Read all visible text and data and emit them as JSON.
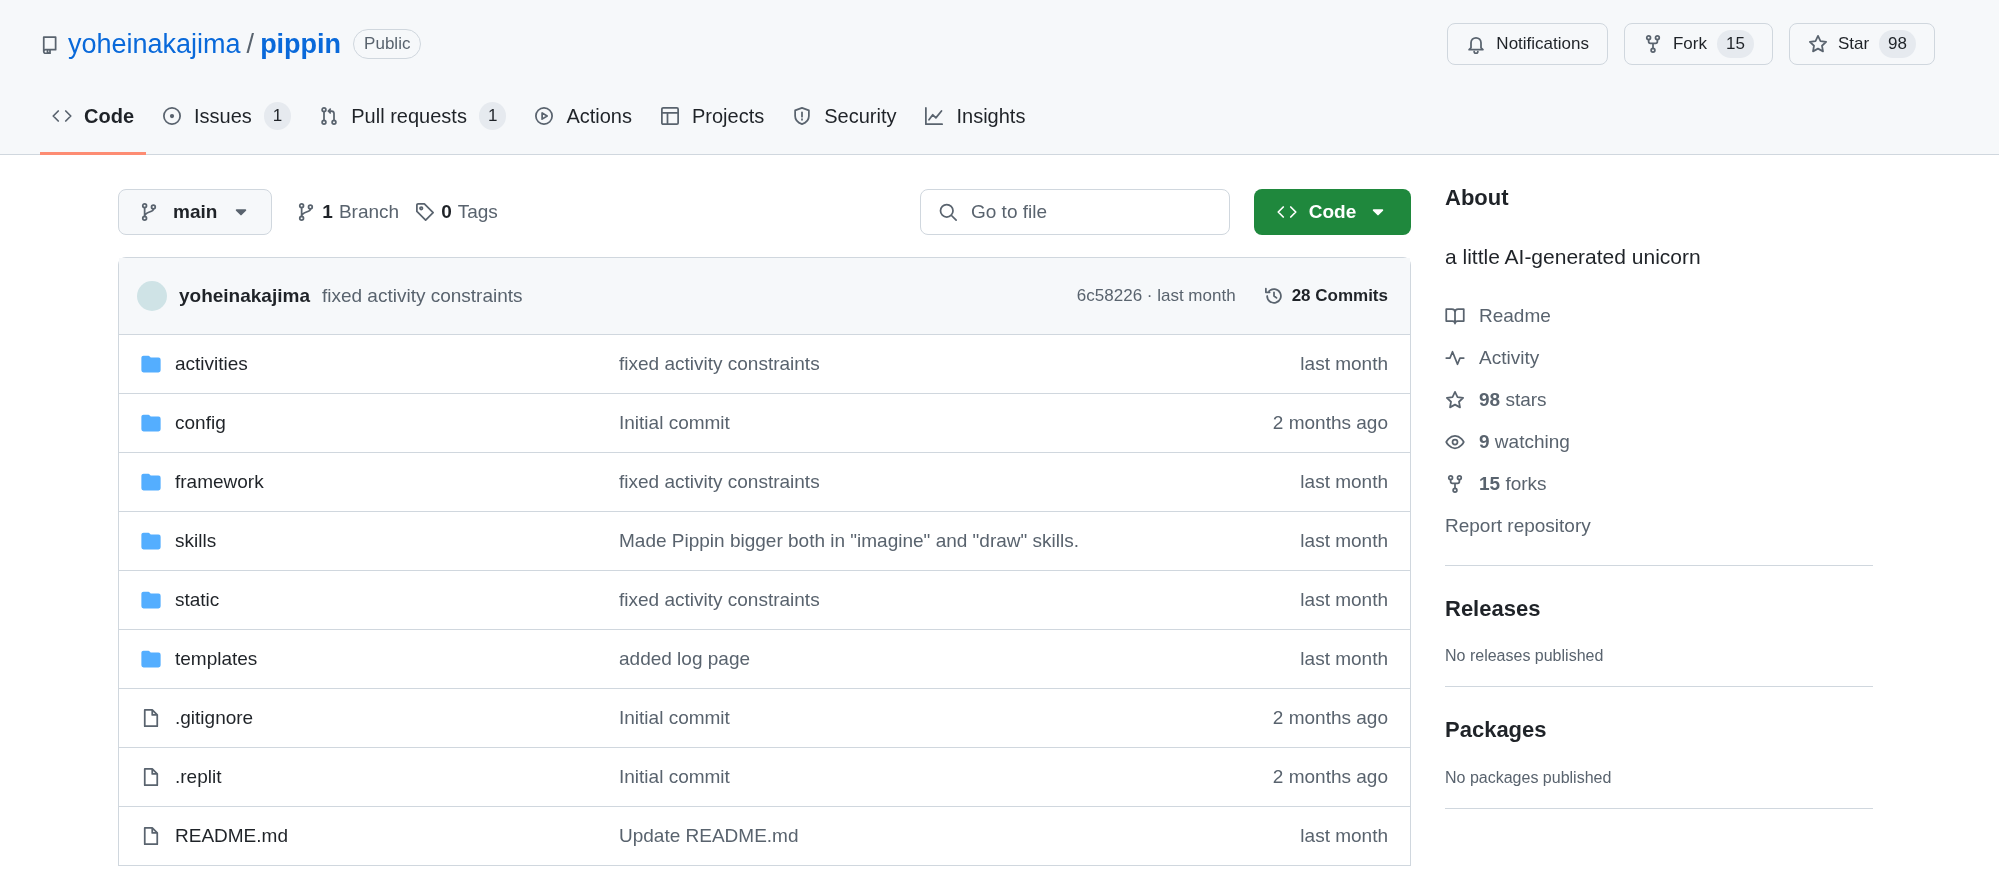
{
  "repo": {
    "owner": "yoheinakajima",
    "separator": "/",
    "name": "pippin",
    "visibility": "Public"
  },
  "actions": [
    {
      "kind": "notifications",
      "label": "Notifications"
    },
    {
      "kind": "fork",
      "label": "Fork",
      "count": "15"
    },
    {
      "kind": "star",
      "label": "Star",
      "count": "98"
    }
  ],
  "tabs": [
    {
      "kind": "code",
      "label": "Code",
      "selected": true
    },
    {
      "kind": "issues",
      "label": "Issues",
      "count": "1",
      "selected": false
    },
    {
      "kind": "pulls",
      "label": "Pull requests",
      "count": "1",
      "selected": false
    },
    {
      "kind": "actions",
      "label": "Actions",
      "selected": false
    },
    {
      "kind": "projects",
      "label": "Projects",
      "selected": false
    },
    {
      "kind": "security",
      "label": "Security",
      "selected": false
    },
    {
      "kind": "insights",
      "label": "Insights",
      "selected": false
    }
  ],
  "toolbar": {
    "branch": "main",
    "branches": {
      "count": "1",
      "label": "Branch"
    },
    "tags": {
      "count": "0",
      "label": "Tags"
    },
    "search": {
      "placeholder": "Go to file"
    },
    "code_button": "Code"
  },
  "commit": {
    "author": "yoheinakajima",
    "message": "fixed activity constraints",
    "meta": "6c58226 · last month",
    "commits": {
      "count": "28",
      "label": "Commits"
    }
  },
  "files": [
    {
      "kind": "folder",
      "name": "activities",
      "message": "fixed activity constraints",
      "time": "last month"
    },
    {
      "kind": "folder",
      "name": "config",
      "message": "Initial commit",
      "time": "2 months ago"
    },
    {
      "kind": "folder",
      "name": "framework",
      "message": "fixed activity constraints",
      "time": "last month"
    },
    {
      "kind": "folder",
      "name": "skills",
      "message": "Made Pippin bigger both in \"imagine\" and \"draw\" skills.",
      "time": "last month"
    },
    {
      "kind": "folder",
      "name": "static",
      "message": "fixed activity constraints",
      "time": "last month"
    },
    {
      "kind": "folder",
      "name": "templates",
      "message": "added log page",
      "time": "last month"
    },
    {
      "kind": "file",
      "name": ".gitignore",
      "message": "Initial commit",
      "time": "2 months ago"
    },
    {
      "kind": "file",
      "name": ".replit",
      "message": "Initial commit",
      "time": "2 months ago"
    },
    {
      "kind": "file",
      "name": "README.md",
      "message": "Update README.md",
      "time": "last month"
    }
  ],
  "about": {
    "title": "About",
    "description": "a little AI-generated unicorn",
    "links": [
      {
        "kind": "readme",
        "label": "Readme"
      },
      {
        "kind": "activity",
        "label": "Activity"
      },
      {
        "kind": "stars",
        "count": "98",
        "label": "stars"
      },
      {
        "kind": "watchers",
        "count": "9",
        "label": "watching"
      },
      {
        "kind": "forks",
        "count": "15",
        "label": "forks"
      },
      {
        "kind": "report",
        "label": "Report repository"
      }
    ]
  },
  "sections": [
    {
      "title": "Releases",
      "note": "No releases published"
    },
    {
      "title": "Packages",
      "note": "No packages published"
    }
  ]
}
